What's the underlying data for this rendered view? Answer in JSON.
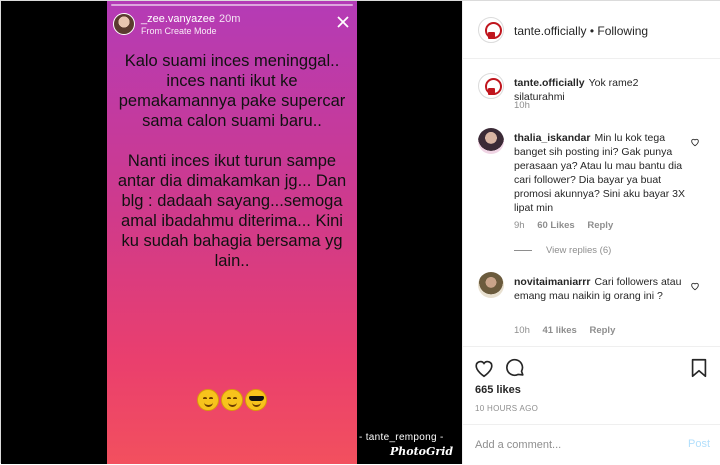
{
  "story": {
    "username": "_zee.vanyazee",
    "time": "20m",
    "mode": "From Create Mode",
    "paragraph1": "Kalo suami inces meninggal.. inces nanti ikut ke pemakamannya pake supercar sama calon suami baru..",
    "paragraph2": "Nanti inces ikut turun sampe antar dia dimakamkan jg... Dan blg : dadaah sayang...semoga amal ibadahmu diterima... Kini ku sudah bahagia bersama yg lain..",
    "emojis": [
      "smiling-face-emoji",
      "smiling-face-emoji",
      "sunglasses-face-emoji"
    ]
  },
  "watermark": {
    "credit": "- tante_rempong -",
    "app": "PhotoGrid"
  },
  "post": {
    "account": "tante.officially",
    "follow_status": "Following",
    "separator": "•",
    "caption": {
      "user": "tante.officially",
      "text": "Yok rame2 silaturahmi",
      "time": "10h"
    },
    "comments": [
      {
        "user": "thalia_iskandar",
        "text": "Min lu kok tega banget sih posting ini? Gak punya perasaan ya? Atau lu mau bantu dia cari follower? Dia bayar ya buat promosi akunnya? Sini aku bayar 3X lipat min",
        "time": "9h",
        "likes": "60 Likes",
        "reply": "Reply",
        "view_replies": "View replies (6)"
      },
      {
        "user": "novitaimaniarrr",
        "text": "Cari followers atau emang mau naikin ig orang ini ?",
        "time": "10h",
        "likes": "41 likes",
        "reply": "Reply"
      }
    ],
    "likes": "665 likes",
    "posted": "10 HOURS AGO",
    "add_comment_placeholder": "Add a comment...",
    "post_button": "Post"
  },
  "colors": {
    "story_gradient_top": "#b43bb6",
    "story_gradient_bottom": "#f2505e",
    "post_button": "#b2dffc",
    "text": "#262626",
    "muted": "#8e8e8e"
  }
}
